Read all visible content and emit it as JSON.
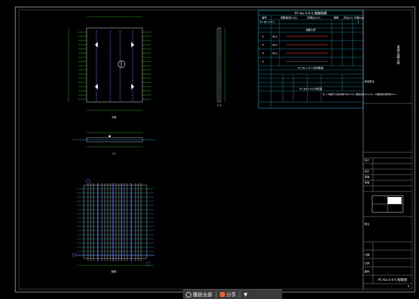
{
  "table": {
    "title": "PC-6a-3-4-5-钢筋明细",
    "headers": [
      "编号",
      "钢筋直径(mm)",
      "每根长(cm)",
      "根数",
      "共长(m)",
      "共重(kg)"
    ],
    "row0": [
      "PC-6a-3-4-5",
      "",
      "",
      "",
      "",
      "5"
    ],
    "sub1": "钢筋大样",
    "rows": [
      {
        "no": "①",
        "dia": "Φ12",
        "len": "",
        "cnt": "",
        "tl": "",
        "wt": ""
      },
      {
        "no": "②",
        "dia": "Φ12",
        "len": "",
        "cnt": "",
        "tl": "",
        "wt": ""
      },
      {
        "no": "③",
        "dia": "Φ12",
        "len": "",
        "cnt": "",
        "tl": "",
        "wt": ""
      },
      {
        "no": "④",
        "dia": "",
        "len": "",
        "cnt": "",
        "tl": "",
        "wt": ""
      }
    ],
    "sub2": "PC-6a-3-4-5-材料数量",
    "sub3": "PC-6a-3-4-5-材料表",
    "note": "注: 1.本图尺寸除注明外均以cm计, 钢筋直径以mm计。2.钢筋保护层厚度3cm。"
  },
  "title_block": {
    "project": "某某公路工程",
    "design": "设计",
    "designer": "设计",
    "checker": "复核",
    "reviewer": "审核",
    "date": "日期",
    "scale": "比例",
    "drawing_no": "图号",
    "drawing_title": "PC-6a-3-4-5-配筋图",
    "note_label": "附注",
    "sig_label": "审查意见",
    "page_no": "6"
  },
  "views": {
    "plan_label": "平面",
    "elev_label": "1-1",
    "section_label": "2-2",
    "rebar_label": "配筋"
  },
  "taskbar": {
    "play_label": "播放全部",
    "share_label": "分享",
    "menu_label": "▼"
  }
}
